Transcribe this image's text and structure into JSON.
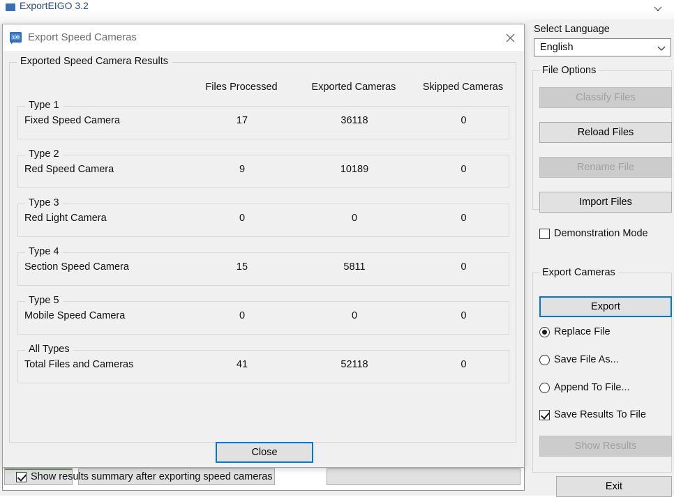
{
  "app": {
    "title": "ExportEIGO 3.2",
    "close_icon": "close-icon"
  },
  "dialog": {
    "title": "Export Speed Cameras",
    "icon": "speed-limit-sign-icon",
    "close_icon": "close-icon",
    "group_legend": "Exported Speed Camera Results",
    "columns": [
      "Files Processed",
      "Exported Cameras",
      "Skipped Cameras"
    ],
    "rows": [
      {
        "type": "Type 1",
        "name": "Fixed Speed Camera",
        "files_processed": "17",
        "exported_cameras": "36118",
        "skipped_cameras": "0"
      },
      {
        "type": "Type 2",
        "name": "Red Speed Camera",
        "files_processed": "9",
        "exported_cameras": "10189",
        "skipped_cameras": "0"
      },
      {
        "type": "Type 3",
        "name": "Red Light Camera",
        "files_processed": "0",
        "exported_cameras": "0",
        "skipped_cameras": "0"
      },
      {
        "type": "Type 4",
        "name": "Section Speed Camera",
        "files_processed": "15",
        "exported_cameras": "5811",
        "skipped_cameras": "0"
      },
      {
        "type": "Type 5",
        "name": "Mobile Speed Camera",
        "files_processed": "0",
        "exported_cameras": "0",
        "skipped_cameras": "0"
      },
      {
        "type": "All Types",
        "name": "Total Files and Cameras",
        "files_processed": "41",
        "exported_cameras": "52118",
        "skipped_cameras": "0"
      }
    ],
    "close_button": "Close",
    "show_summary_checkbox": {
      "label": "Show results summary after exporting speed cameras",
      "checked": true
    }
  },
  "sidebar": {
    "language_label": "Select Language",
    "language_value": "English",
    "language_chevron_icon": "chevron-down-icon",
    "file_options": {
      "legend": "File Options",
      "buttons": [
        {
          "label": "Classify Files",
          "enabled": false
        },
        {
          "label": "Reload Files",
          "enabled": true
        },
        {
          "label": "Rename File",
          "enabled": false
        },
        {
          "label": "Import Files",
          "enabled": true
        }
      ],
      "demonstration_mode": {
        "label": "Demonstration Mode",
        "checked": false
      }
    },
    "export_cameras": {
      "legend": "Export Cameras",
      "export_button": "Export",
      "radios": [
        {
          "label": "Replace File",
          "selected": true
        },
        {
          "label": "Save File As...",
          "selected": false
        },
        {
          "label": "Append To File...",
          "selected": false
        }
      ],
      "save_results_checkbox": {
        "label": "Save Results To File",
        "checked": true
      },
      "show_results_button": {
        "label": "Show Results",
        "enabled": false
      }
    },
    "exit_button": "Exit"
  },
  "colors": {
    "window_bg": "#f0f0f0",
    "accent_blue": "#0078d7",
    "button_face": "#e1e1e1",
    "disabled_face": "#cccccc",
    "disabled_text": "#a0a0a0",
    "title_text": "#6c6c6c"
  }
}
